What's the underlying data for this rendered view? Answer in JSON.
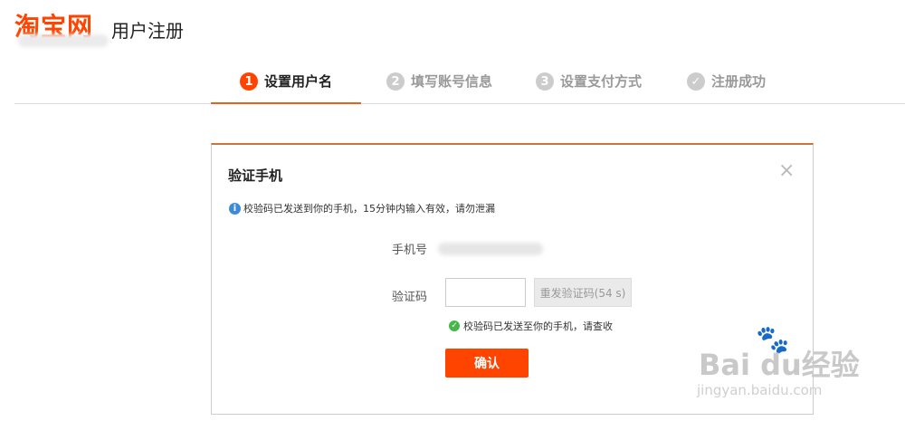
{
  "header": {
    "logo_text": "淘宝网",
    "page_title": "用户注册"
  },
  "steps": [
    {
      "num": "1",
      "label": "设置用户名",
      "active": true
    },
    {
      "num": "2",
      "label": "填写账号信息",
      "active": false
    },
    {
      "num": "3",
      "label": "设置支付方式",
      "active": false
    },
    {
      "num": "✓",
      "label": "注册成功",
      "active": false
    }
  ],
  "dialog": {
    "title": "验证手机",
    "close_glyph": "×",
    "info_text": "校验码已发送到你的手机，15分钟内输入有效，请勿泄漏",
    "phone_label": "手机号",
    "code_label": "验证码",
    "code_value": "",
    "resend_label": "重发验证码(54 s)",
    "sent_text": "校验码已发送至你的手机，请查收",
    "confirm_label": "确认"
  },
  "watermark": {
    "main": "Bai du经验",
    "sub": "jingyan.baidu.com"
  },
  "colors": {
    "brand": "#ff4400",
    "step_underline": "#e0641c",
    "info": "#3c8bd7",
    "success": "#45b649"
  }
}
